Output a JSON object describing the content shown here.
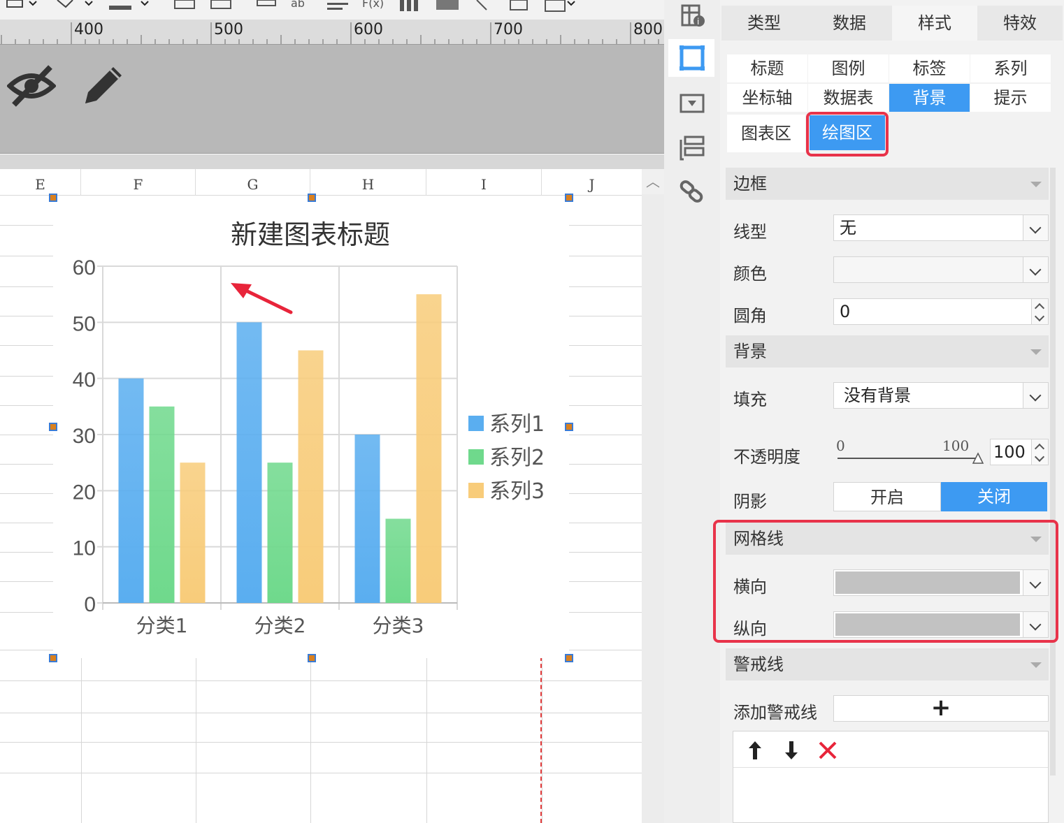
{
  "ruler": {
    "marks": [
      "400",
      "500",
      "600",
      "700",
      "800"
    ]
  },
  "columns": [
    "E",
    "F",
    "G",
    "H",
    "I",
    "J"
  ],
  "chart_data": {
    "type": "bar",
    "title": "新建图表标题",
    "categories": [
      "分类1",
      "分类2",
      "分类3"
    ],
    "series": [
      {
        "name": "系列1",
        "values": [
          40,
          50,
          30
        ],
        "color": "#5aaef0"
      },
      {
        "name": "系列2",
        "values": [
          35,
          25,
          15
        ],
        "color": "#6fd98c"
      },
      {
        "name": "系列3",
        "values": [
          25,
          45,
          55
        ],
        "color": "#f8cc7a"
      }
    ],
    "ylim": [
      0,
      60
    ],
    "yticks": [
      "0",
      "10",
      "20",
      "30",
      "40",
      "50",
      "60"
    ],
    "grid": true,
    "legend": "right"
  },
  "panel": {
    "top_tabs": [
      "类型",
      "数据",
      "样式",
      "特效"
    ],
    "sub_tabs_row1": [
      "标题",
      "图例",
      "标签",
      "系列"
    ],
    "sub_tabs_row2": [
      "坐标轴",
      "数据表",
      "背景",
      "提示"
    ],
    "area_tabs": [
      "图表区",
      "绘图区"
    ],
    "border": {
      "heading": "边框",
      "line_type_label": "线型",
      "line_type_value": "无",
      "color_label": "颜色",
      "radius_label": "圆角",
      "radius_value": "0"
    },
    "background": {
      "heading": "背景",
      "fill_label": "填充",
      "fill_value": "没有背景",
      "opacity_label": "不透明度",
      "opacity_min": "0",
      "opacity_max": "100",
      "opacity_value": "100",
      "shadow_label": "阴影",
      "shadow_on": "开启",
      "shadow_off": "关闭"
    },
    "gridlines": {
      "heading": "网格线",
      "horizontal_label": "横向",
      "vertical_label": "纵向",
      "color": "#c2c2c2"
    },
    "warning": {
      "heading": "警戒线",
      "add_label": "添加警戒线",
      "add_symbol": "+"
    }
  },
  "colors": {
    "accent": "#3d9af2",
    "highlight": "#e8334a"
  }
}
